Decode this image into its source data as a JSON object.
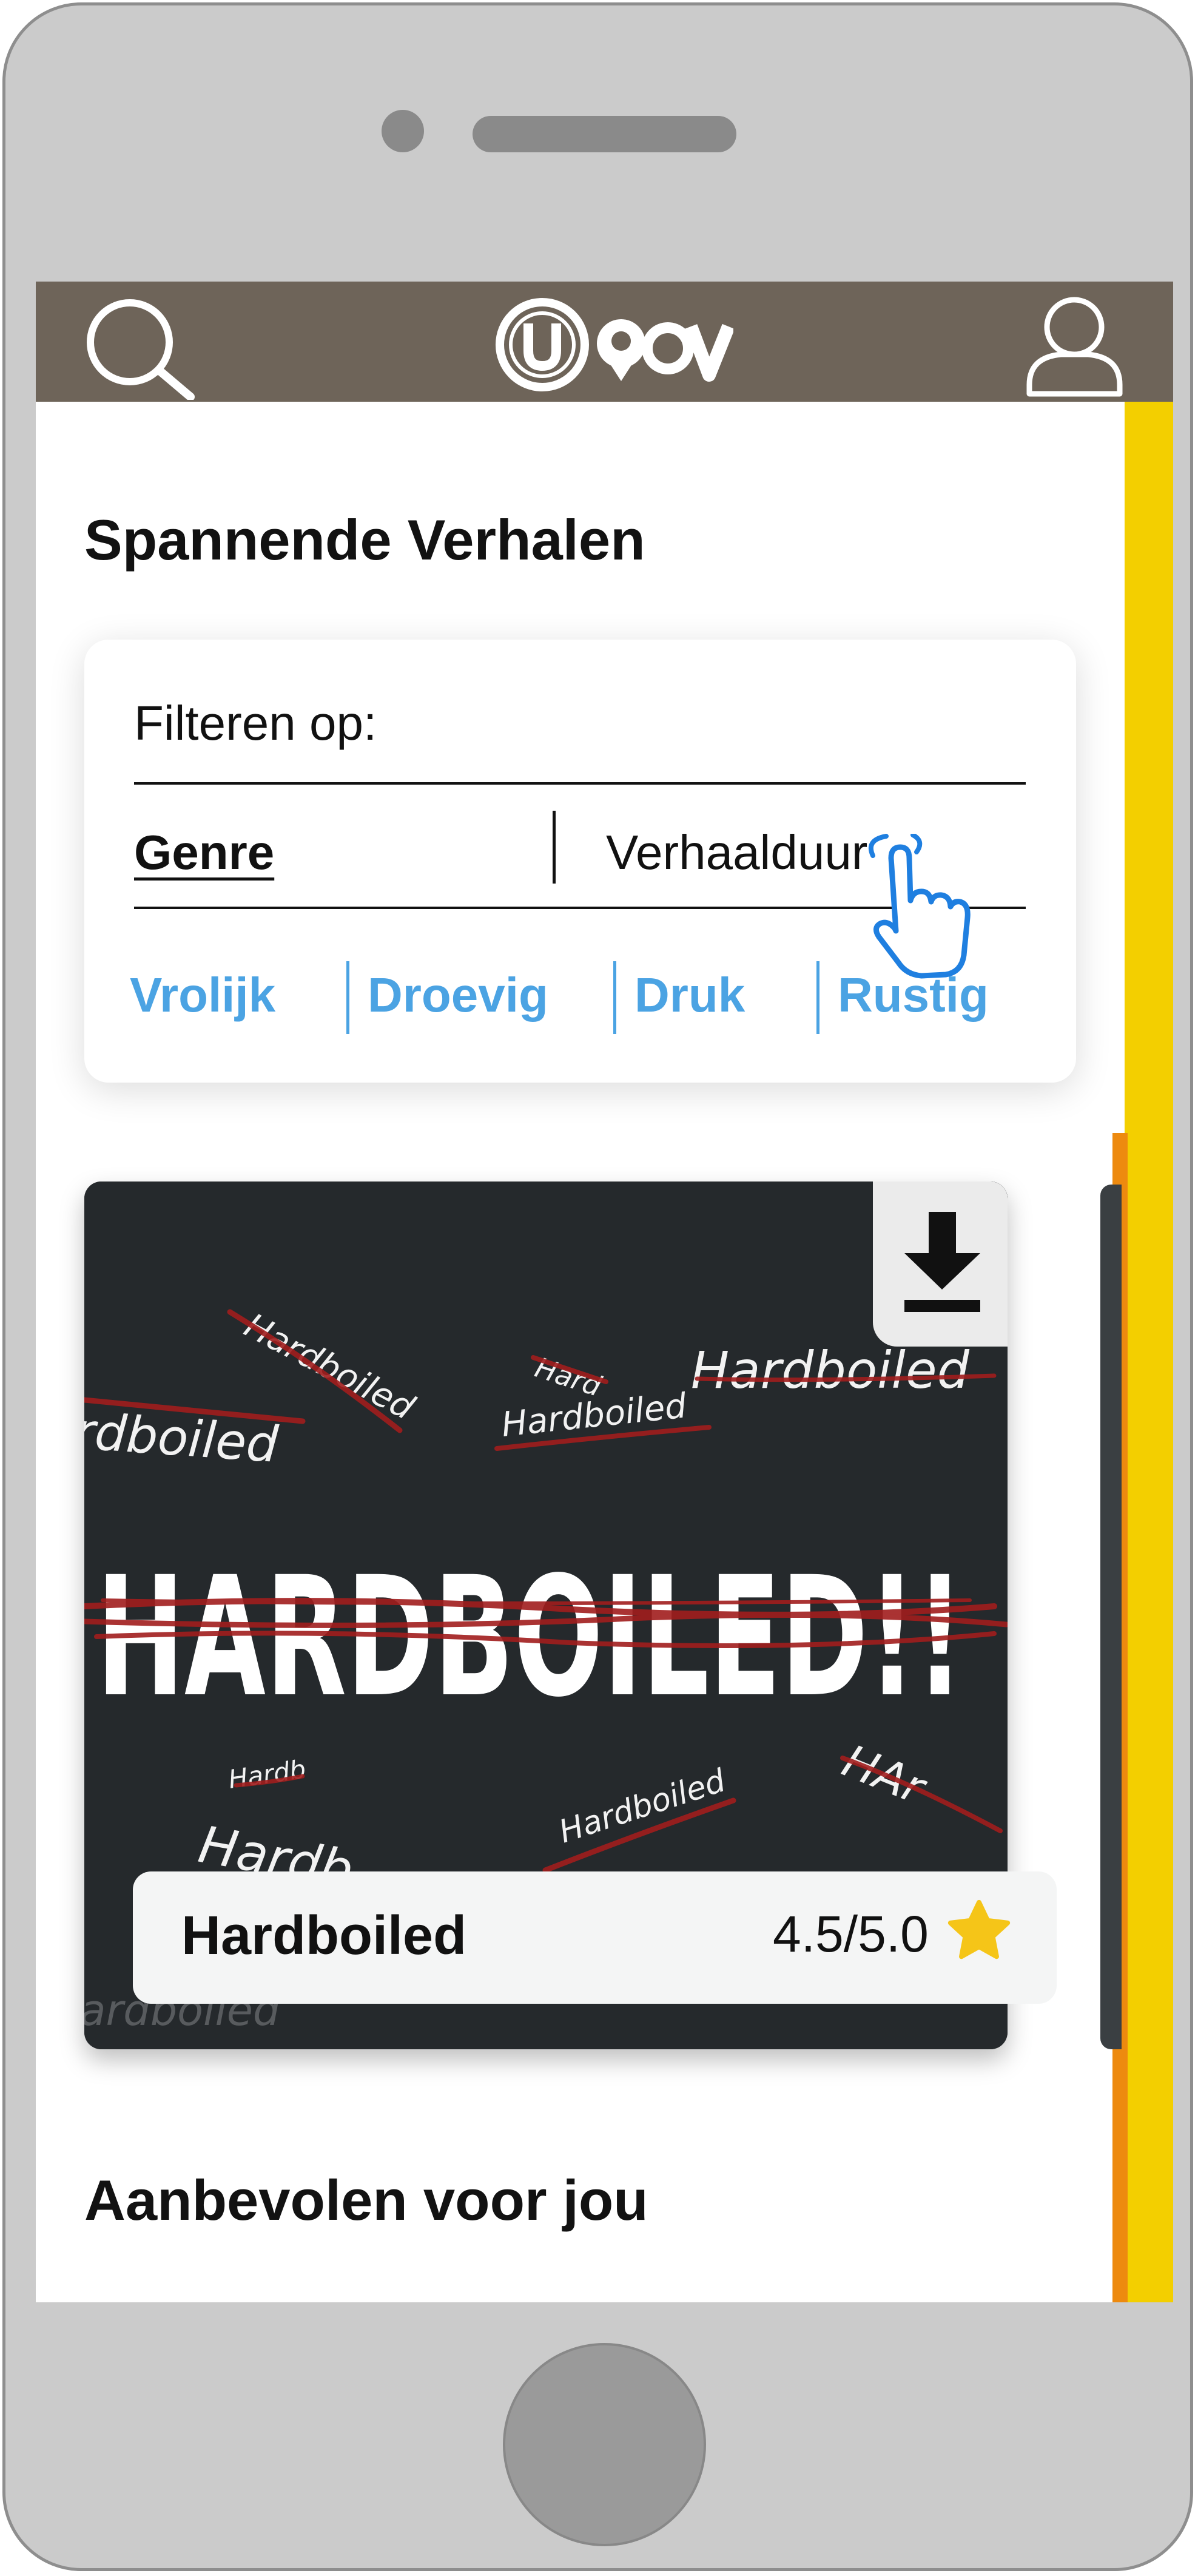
{
  "app": {
    "logo_text": "UOV"
  },
  "header": {
    "search_icon": "search-icon",
    "profile_icon": "user-icon"
  },
  "section1": {
    "title": "Spannende Verhalen"
  },
  "filter": {
    "label": "Filteren op:",
    "tabs": [
      {
        "label": "Genre",
        "active": true
      },
      {
        "label": "Verhaalduur",
        "active": false
      }
    ],
    "chips": [
      "Vrolijk",
      "Droevig",
      "Druk",
      "Rustig"
    ],
    "chip_color": "#4ba3e3"
  },
  "story": {
    "title": "Hardboiled",
    "rating": "4.5/5.0",
    "cover_text": "HARDBOILED!!",
    "cover_scribbles": [
      "Hardboiled",
      "Hardboiled",
      "Hardboiled",
      "Hardboiled",
      "Hardboiled",
      "Hardb",
      "Hardb",
      "Hard",
      "HAr",
      "Hardboiled"
    ],
    "download_icon": "download-icon",
    "star_icon": "star-icon",
    "star_color": "#f5c518"
  },
  "section2": {
    "title": "Aanbevolen voor jou"
  },
  "colors": {
    "header_bg": "#6e6459",
    "accent_yellow": "#f3cf00",
    "accent_orange": "#ed8a0f",
    "cover_bg": "#25292c"
  }
}
